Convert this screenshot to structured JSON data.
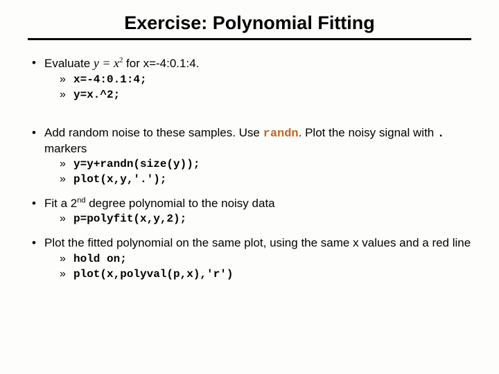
{
  "title": "Exercise: Polynomial Fitting",
  "b1": {
    "pre": "Evaluate ",
    "formula": "y = x",
    "exp": "2",
    "post": " for x=-4:0.1:4.",
    "code1": "x=-4:0.1:4;",
    "code2": "y=x.^2;"
  },
  "b2": {
    "text_a": "Add random noise to these samples. Use ",
    "kw": "randn",
    "text_b": ". Plot the noisy signal with ",
    "dot": ".",
    "text_c": " markers",
    "code1": "y=y+randn(size(y));",
    "code2": "plot(x,y,'.');"
  },
  "b3": {
    "text_a": "Fit a 2",
    "sup": "nd",
    "text_b": " degree polynomial to the noisy data",
    "code1": "p=polyfit(x,y,2);"
  },
  "b4": {
    "text": "Plot the fitted polynomial on the same plot, using the same x values and a red line",
    "code1": "hold on;",
    "code2": "plot(x,polyval(p,x),'r')"
  }
}
